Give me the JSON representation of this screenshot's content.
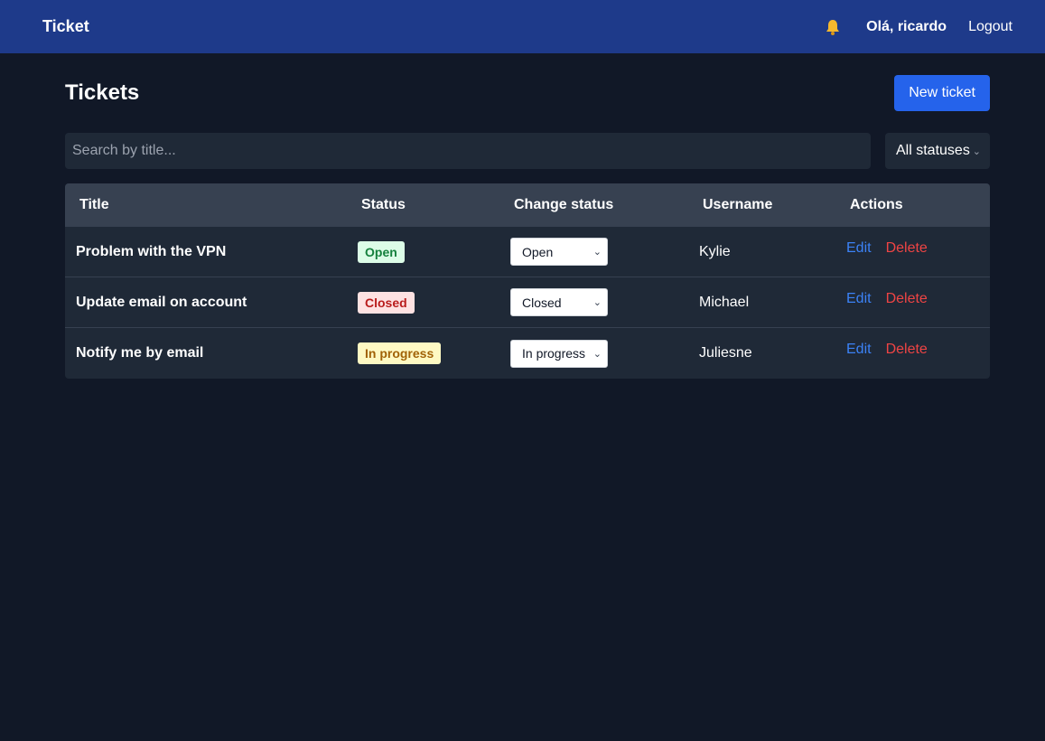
{
  "navbar": {
    "brand": "Ticket",
    "greeting": "Olá, ricardo",
    "logout": "Logout",
    "bell_icon": "bell-icon"
  },
  "page": {
    "title": "Tickets",
    "new_ticket": "New ticket"
  },
  "search": {
    "placeholder": "Search by title...",
    "value": ""
  },
  "status_filter": {
    "selected": "All statuses"
  },
  "table": {
    "headers": [
      "Title",
      "Status",
      "Change status",
      "Username",
      "Actions"
    ],
    "rows": [
      {
        "title": "Problem with the VPN",
        "status": "Open",
        "change_status": "Open",
        "username": "Kylie",
        "edit": "Edit",
        "delete": "Delete"
      },
      {
        "title": "Update email on account",
        "status": "Closed",
        "change_status": "Closed",
        "username": "Michael",
        "edit": "Edit",
        "delete": "Delete"
      },
      {
        "title": "Notify me by email",
        "status": "In progress",
        "change_status": "In progress",
        "username": "Juliesne",
        "edit": "Edit",
        "delete": "Delete"
      }
    ]
  },
  "colors": {
    "navbar": "#1e3a8a",
    "background": "#111827",
    "primary": "#2563eb",
    "edit": "#3b82f6",
    "delete": "#ef4444"
  }
}
